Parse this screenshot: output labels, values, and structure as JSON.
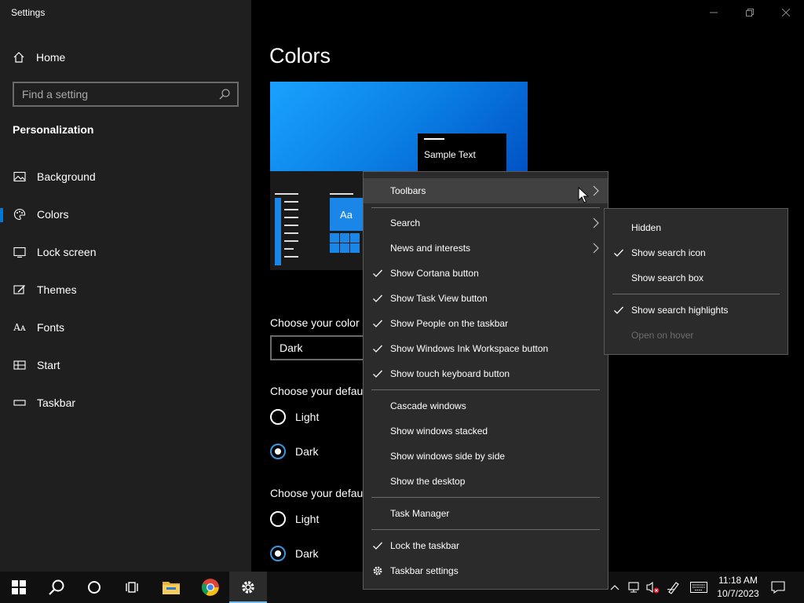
{
  "window": {
    "title": "Settings",
    "controls": {
      "minimize": "minimize-icon",
      "maximize": "restore-icon",
      "close": "close-icon"
    }
  },
  "sidebar": {
    "home": "Home",
    "search_placeholder": "Find a setting",
    "section": "Personalization",
    "items": [
      {
        "label": "Background",
        "icon": "picture-icon"
      },
      {
        "label": "Colors",
        "icon": "palette-icon",
        "active": true
      },
      {
        "label": "Lock screen",
        "icon": "lock-screen-icon"
      },
      {
        "label": "Themes",
        "icon": "brush-icon"
      },
      {
        "label": "Fonts",
        "icon": "font-icon"
      },
      {
        "label": "Start",
        "icon": "start-icon"
      },
      {
        "label": "Taskbar",
        "icon": "taskbar-icon"
      }
    ]
  },
  "main": {
    "title": "Colors",
    "preview": {
      "sample_text": "Sample Text",
      "tile_text": "Aa"
    },
    "choose_color_label": "Choose your color",
    "color_value": "Dark",
    "windows_mode_label": "Choose your defau",
    "windows_mode_options": [
      {
        "label": "Light",
        "selected": false
      },
      {
        "label": "Dark",
        "selected": true
      }
    ],
    "app_mode_label": "Choose your defau",
    "app_mode_options": [
      {
        "label": "Light",
        "selected": false
      },
      {
        "label": "Dark",
        "selected": true
      }
    ]
  },
  "context_menu": {
    "items": [
      {
        "label": "Toolbars",
        "submenu": true,
        "hover": true
      },
      {
        "label": "Search",
        "submenu": true
      },
      {
        "label": "News and interests",
        "submenu": true
      },
      {
        "label": "Show Cortana button",
        "checked": true
      },
      {
        "label": "Show Task View button",
        "checked": true
      },
      {
        "label": "Show People on the taskbar",
        "checked": true
      },
      {
        "label": "Show Windows Ink Workspace button",
        "checked": true
      },
      {
        "label": "Show touch keyboard button",
        "checked": true
      },
      {
        "label": "Cascade windows"
      },
      {
        "label": "Show windows stacked"
      },
      {
        "label": "Show windows side by side"
      },
      {
        "label": "Show the desktop"
      },
      {
        "label": "Task Manager"
      },
      {
        "label": "Lock the taskbar",
        "checked": true
      },
      {
        "label": "Taskbar settings",
        "icon": "gear-icon"
      }
    ]
  },
  "search_submenu": {
    "items": [
      {
        "label": "Hidden"
      },
      {
        "label": "Show search icon",
        "checked": true
      },
      {
        "label": "Show search box"
      },
      {
        "label": "Show search highlights",
        "checked": true
      },
      {
        "label": "Open on hover",
        "disabled": true
      }
    ]
  },
  "taskbar": {
    "pinned": [
      "windows-start-icon",
      "search-icon",
      "cortana-icon",
      "task-view-icon",
      "file-explorer-icon",
      "chrome-icon",
      "settings-gear-icon"
    ],
    "tray": [
      "chevron-up-icon",
      "network-icon",
      "volume-muted-icon",
      "pen-icon",
      "keyboard-icon",
      "notification-icon"
    ],
    "time": "11:18 AM",
    "date": "10/7/2023"
  },
  "colors": {
    "accent": "#0078d7",
    "menu_bg": "#2b2b2b",
    "sidebar_bg": "#1f1f1f"
  }
}
